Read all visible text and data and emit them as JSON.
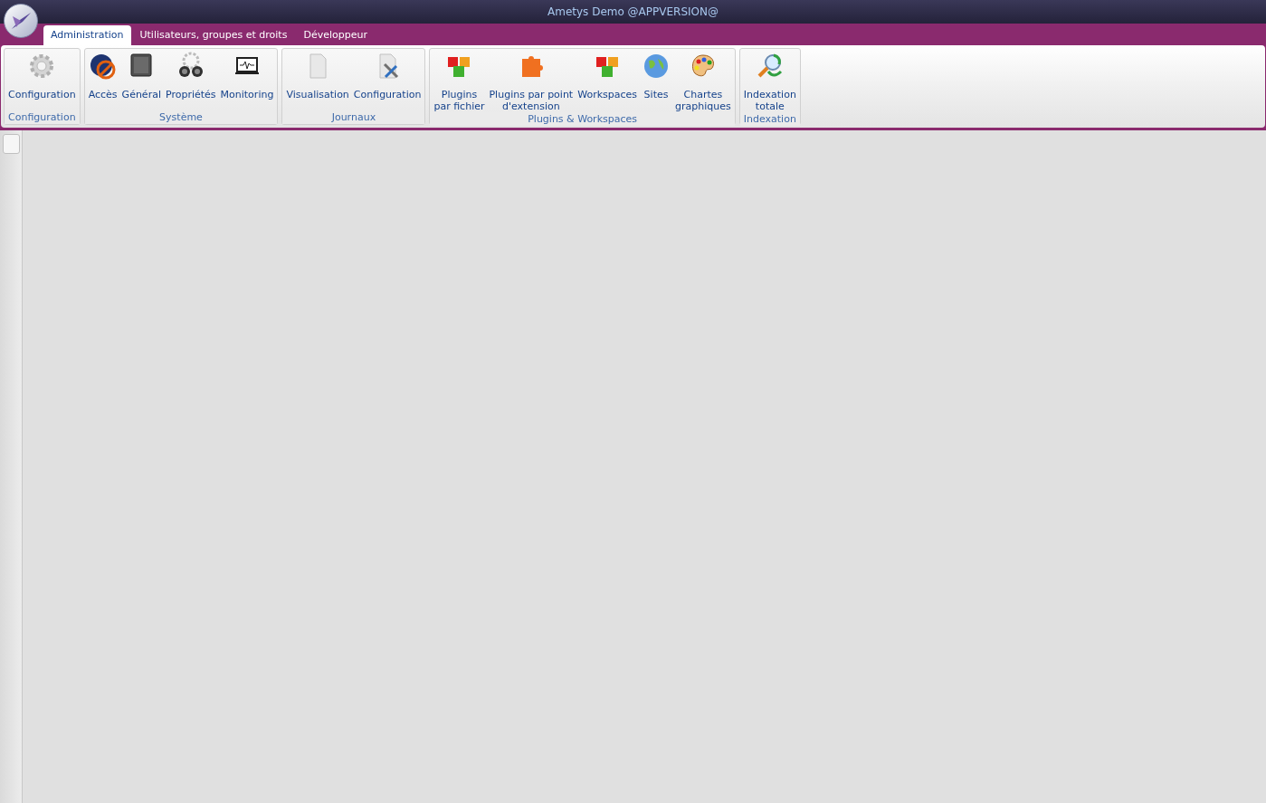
{
  "window": {
    "title": "Ametys Demo @APPVERSION@"
  },
  "tabs": [
    {
      "label": "Administration",
      "selected": true
    },
    {
      "label": "Utilisateurs, groupes et droits",
      "selected": false
    },
    {
      "label": "Développeur",
      "selected": false
    }
  ],
  "ribbon_groups": [
    {
      "label": "Configuration",
      "buttons": [
        {
          "label": "Configuration"
        }
      ]
    },
    {
      "label": "Système",
      "buttons": [
        {
          "label": "Accès"
        },
        {
          "label": "Général"
        },
        {
          "label": "Propriétés"
        },
        {
          "label": "Monitoring"
        }
      ]
    },
    {
      "label": "Journaux",
      "buttons": [
        {
          "label": "Visualisation"
        },
        {
          "label": "Configuration"
        }
      ]
    },
    {
      "label": "Plugins & Workspaces",
      "buttons": [
        {
          "label": "Plugins\npar fichier"
        },
        {
          "label": "Plugins par point\nd'extension"
        },
        {
          "label": "Workspaces"
        },
        {
          "label": "Sites"
        },
        {
          "label": "Chartes\ngraphiques"
        }
      ]
    },
    {
      "label": "Indexation",
      "buttons": [
        {
          "label": "Indexation\ntotale"
        }
      ]
    }
  ]
}
